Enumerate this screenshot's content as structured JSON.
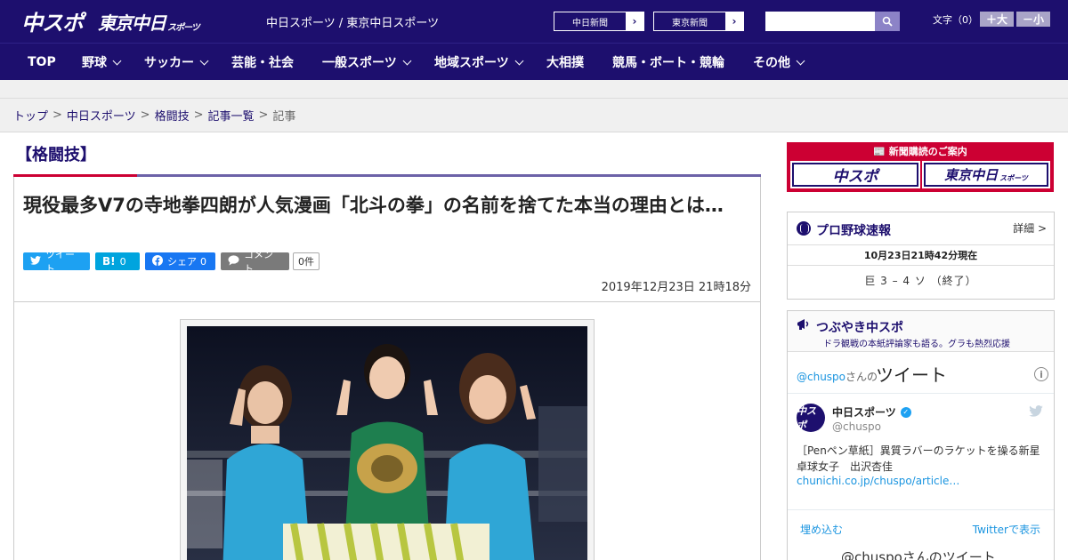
{
  "header": {
    "logo_primary": "中スポ",
    "logo_secondary": "東京中日",
    "logo_secondary_small": "スポーツ",
    "site_title": "中日スポーツ / 東京中日スポーツ",
    "paper_links": [
      {
        "label": "中日新聞"
      },
      {
        "label": "東京新聞"
      }
    ],
    "search_placeholder": "",
    "font_size_label": "文字（0）",
    "font_larger": "＋大",
    "font_smaller": "－小"
  },
  "nav": {
    "items": [
      {
        "label": "TOP"
      },
      {
        "label": "野球"
      },
      {
        "label": "サッカー"
      },
      {
        "label": "芸能・社会"
      },
      {
        "label": "一般スポーツ"
      },
      {
        "label": "地域スポーツ"
      },
      {
        "label": "大相撲"
      },
      {
        "label": "競馬・ボート・競輪"
      },
      {
        "label": "その他"
      }
    ]
  },
  "breadcrumb": {
    "items": [
      "トップ",
      "中日スポーツ",
      "格闘技",
      "記事一覧"
    ],
    "current": "記事"
  },
  "article": {
    "category": "【格闘技】",
    "headline": "現役最多V7の寺地拳四朗が人気漫画「北斗の拳」の名前を捨てた本当の理由とは…",
    "share": {
      "tweet": "ツイート",
      "hatena_icon": "B!",
      "hatena_count": "0",
      "facebook": "シェア",
      "facebook_count": "0",
      "comment": "コメント",
      "comment_count": "0件"
    },
    "date": "2019年12月23日 21時18分"
  },
  "sidebar": {
    "subscription": {
      "title": "新聞購読のご案内",
      "logo_left": "中スポ",
      "logo_right": "東京中日",
      "logo_right_small": "スポーツ"
    },
    "baseball": {
      "title": "プロ野球速報",
      "detail": "詳細 >",
      "as_of": "10月23日21時42分現在",
      "score": "巨 3 – 4 ソ （終了）"
    },
    "tweets": {
      "title": "つぶやき中スポ",
      "subtitle": "ドラ観戦の本紙評論家も語る。グラも熱烈応援",
      "handle": "@chuspo",
      "handle_suffix": "さんの",
      "header_big": "ツイート",
      "tweet": {
        "avatar_text": "中スポ",
        "name": "中日スポーツ",
        "handle": "@chuspo",
        "text": "［Penペン草紙］異質ラバーのラケットを操る新星　卓球女子　出沢杏佳",
        "link": "chunichi.co.jp/chuspo/article…"
      },
      "embed": "埋め込む",
      "view_on_twitter": "Twitterで表示",
      "next_header": "@chuspoさんのツイート"
    }
  },
  "colors": {
    "brand_navy": "#1d0f6e",
    "accent_red": "#cc0033",
    "accent_purple": "#6c62a8"
  }
}
